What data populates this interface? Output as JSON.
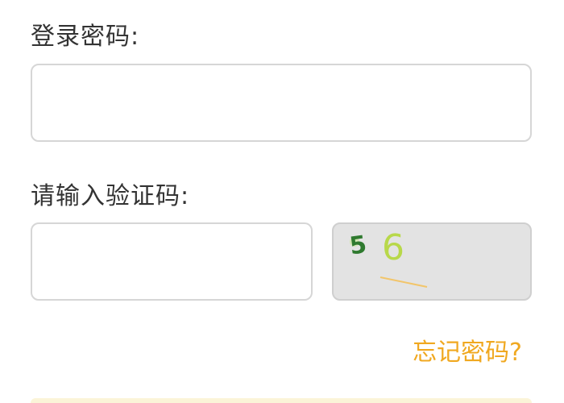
{
  "form": {
    "password_label": "登录密码:",
    "password_value": "",
    "captcha_label": "请输入验证码:",
    "captcha_value": "",
    "captcha_chars": [
      "5",
      "6"
    ],
    "forgot_password_link": "忘记密码?"
  },
  "colors": {
    "link": "#f0a820",
    "captcha_char_1": "#2f7a2f",
    "captcha_char_2": "#b8d84a",
    "captcha_noise": "#f2c56a"
  }
}
